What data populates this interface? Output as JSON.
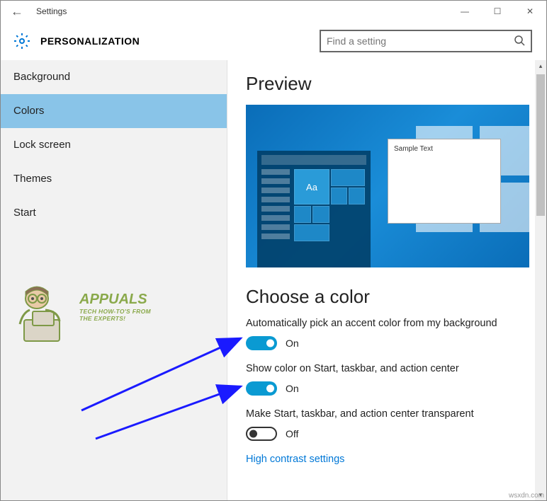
{
  "window": {
    "title": "Settings"
  },
  "header": {
    "title": "PERSONALIZATION",
    "search_placeholder": "Find a setting"
  },
  "sidebar": {
    "items": [
      {
        "label": "Background",
        "active": false
      },
      {
        "label": "Colors",
        "active": true
      },
      {
        "label": "Lock screen",
        "active": false
      },
      {
        "label": "Themes",
        "active": false
      },
      {
        "label": "Start",
        "active": false
      }
    ]
  },
  "content": {
    "preview_heading": "Preview",
    "preview_sample_text": "Sample Text",
    "preview_tile_text": "Aa",
    "choose_heading": "Choose a color",
    "settings": [
      {
        "label": "Automatically pick an accent color from my background",
        "state": "On",
        "on": true
      },
      {
        "label": "Show color on Start, taskbar, and action center",
        "state": "On",
        "on": true
      },
      {
        "label": "Make Start, taskbar, and action center transparent",
        "state": "Off",
        "on": false
      }
    ],
    "link": "High contrast settings"
  },
  "watermark": {
    "title": "APPUALS",
    "subtitle1": "TECH HOW-TO'S FROM",
    "subtitle2": "THE EXPERTS!"
  },
  "credits": "wsxdn.com"
}
